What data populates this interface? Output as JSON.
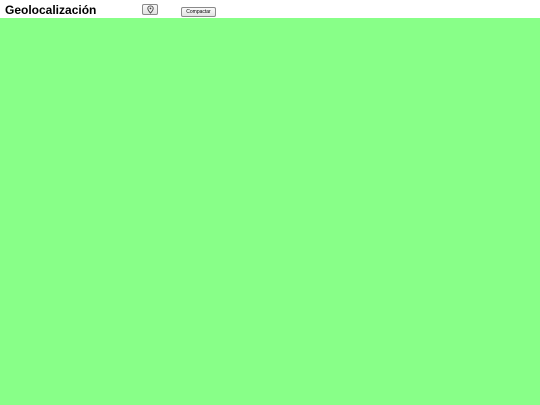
{
  "header": {
    "title": "Geolocalización",
    "locate_icon": "location-pin-icon",
    "compact_label": "Compactar"
  },
  "map": {
    "background_color": "#88ff88"
  }
}
